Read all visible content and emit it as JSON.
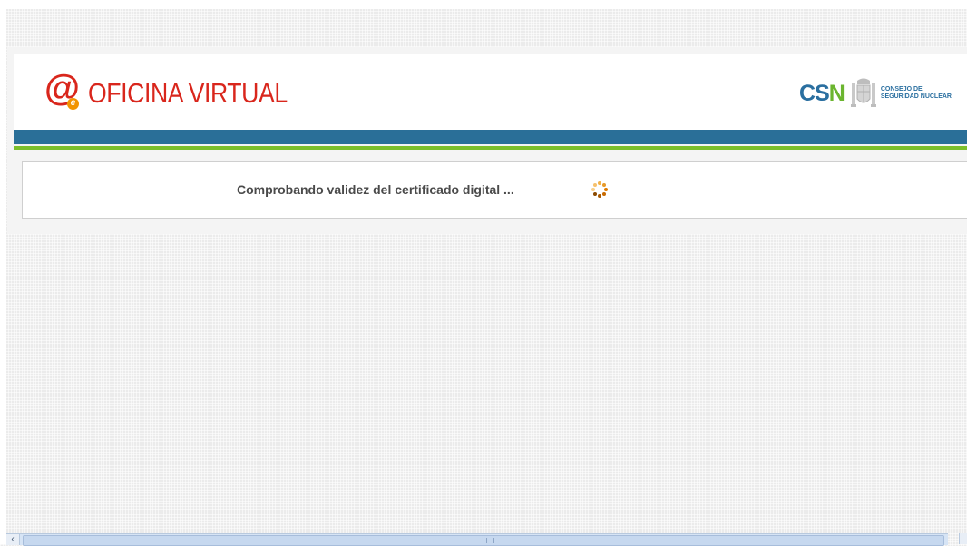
{
  "header": {
    "title": "OFICINA VIRTUAL",
    "logo_icon": "at-sign-e-icon",
    "title_color": "#d9261c",
    "band_color": "#2a6f98",
    "accent_line_color": "#7cbf2b"
  },
  "partner_logo": {
    "csn_c": "C",
    "csn_s": "S",
    "csn_n": "N",
    "caption": "CONSEJO DE\nSEGURIDAD NUCLEAR",
    "crest_icon": "coat-of-arms-icon"
  },
  "status": {
    "message": "Comprobando validez del certificado digital ...",
    "spinner_icon": "loading-spinner-icon",
    "spinner_color": "#e07b00"
  },
  "scrollbar": {
    "left_arrow": "‹",
    "arrow_icon": "chevron-left-icon"
  }
}
